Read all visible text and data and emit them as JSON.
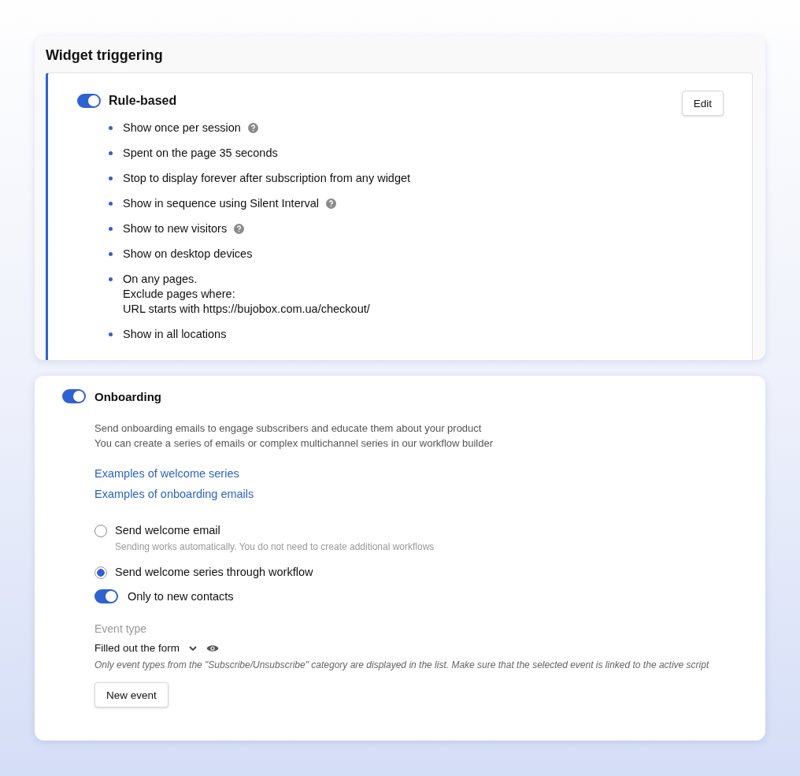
{
  "widget_triggering": {
    "title": "Widget triggering",
    "rule_panel": {
      "toggle_on": true,
      "title": "Rule-based",
      "edit_button": "Edit",
      "rules": [
        {
          "lines": [
            "Show once per session"
          ],
          "help": true
        },
        {
          "lines": [
            "Spent on the page 35 seconds"
          ],
          "help": false
        },
        {
          "lines": [
            "Stop to display forever after subscription from any widget"
          ],
          "help": false
        },
        {
          "lines": [
            "Show in sequence using Silent Interval"
          ],
          "help": true
        },
        {
          "lines": [
            "Show to new visitors"
          ],
          "help": true
        },
        {
          "lines": [
            "Show on desktop devices"
          ],
          "help": false
        },
        {
          "lines": [
            "On any pages.",
            "Exclude pages where:",
            "URL starts with https://bujobox.com.ua/checkout/"
          ],
          "help": false
        },
        {
          "lines": [
            "Show in all locations"
          ],
          "help": false
        }
      ]
    }
  },
  "onboarding": {
    "toggle_on": true,
    "title": "Onboarding",
    "description": [
      "Send onboarding emails to engage subscribers and educate them about your product",
      "You can create a series of emails or complex multichannel series in our workflow builder"
    ],
    "links": [
      "Examples of welcome series",
      "Examples of onboarding emails"
    ],
    "options": [
      {
        "label": "Send welcome email",
        "hint": "Sending works automatically. You do not need to create additional workflows",
        "selected": false
      },
      {
        "label": "Send welcome series through workflow",
        "selected": true
      }
    ],
    "new_contacts_toggle": {
      "label": "Only to new contacts",
      "on": true
    },
    "event_type": {
      "label": "Event type",
      "value": "Filled out the form",
      "note": "Only event types from the \"Subscribe/Unsubscribe\" category are displayed in the list. Make sure that the selected event is linked to the active script"
    },
    "new_event_button": "New event"
  }
}
